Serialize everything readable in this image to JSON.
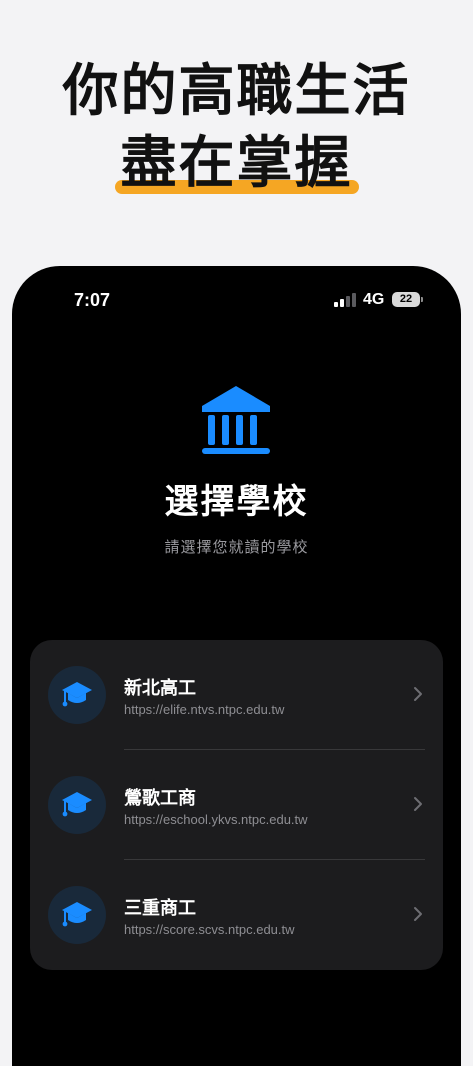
{
  "headline": {
    "line1": "你的高職生活",
    "line2": "盡在掌握",
    "highlight_color": "#f5a623"
  },
  "status_bar": {
    "time": "7:07",
    "network": "4G",
    "battery": "22"
  },
  "header": {
    "icon": "school-building-icon",
    "title": "選擇學校",
    "subtitle": "請選擇您就讀的學校"
  },
  "accent_color": "#1a8cff",
  "schools": [
    {
      "name": "新北高工",
      "url": "https://elife.ntvs.ntpc.edu.tw",
      "icon": "graduation-cap-icon"
    },
    {
      "name": "鶯歌工商",
      "url": "https://eschool.ykvs.ntpc.edu.tw",
      "icon": "graduation-cap-icon"
    },
    {
      "name": "三重商工",
      "url": "https://score.scvs.ntpc.edu.tw",
      "icon": "graduation-cap-icon"
    }
  ]
}
